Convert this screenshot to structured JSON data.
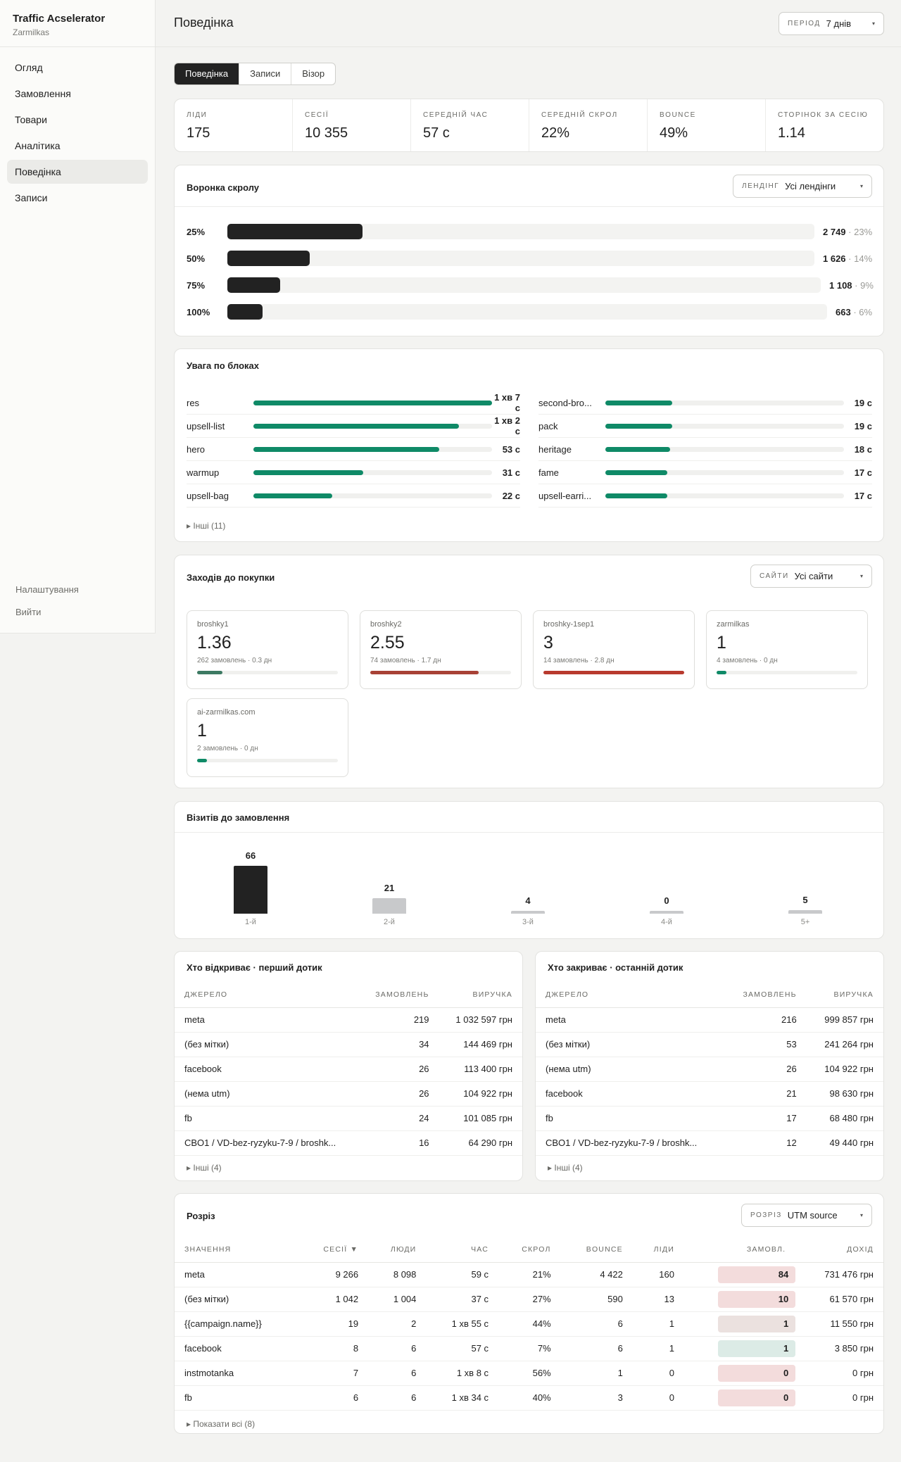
{
  "sidebar": {
    "title": "Traffic Acselerator",
    "subtitle": "Zarmilkas",
    "items": [
      "Огляд",
      "Замовлення",
      "Товари",
      "Аналітика",
      "Поведінка",
      "Записи"
    ],
    "active": 4,
    "footer": [
      "Налаштування",
      "Вийти"
    ]
  },
  "header": {
    "title": "Поведінка",
    "period_label": "ПЕРІОД",
    "period_value": "7 днів"
  },
  "tabs": [
    "Поведінка",
    "Записи",
    "Візор"
  ],
  "kpis": [
    {
      "label": "Ліди",
      "value": "175"
    },
    {
      "label": "Сесії",
      "value": "10 355"
    },
    {
      "label": "Середній час",
      "value": "57 с"
    },
    {
      "label": "Середній скрол",
      "value": "22%"
    },
    {
      "label": "Bounce",
      "value": "49%"
    },
    {
      "label": "Сторінок за сесію",
      "value": "1.14"
    }
  ],
  "funnel": {
    "title": "Воронка скролу",
    "filter_label": "ЛЕНДІНГ",
    "filter_value": "Усі лендінги",
    "rows": [
      {
        "pct": "25%",
        "count": "2 749",
        "share": "23%",
        "fill": 0.23
      },
      {
        "pct": "50%",
        "count": "1 626",
        "share": "14%",
        "fill": 0.14
      },
      {
        "pct": "75%",
        "count": "1 108",
        "share": "9%",
        "fill": 0.09
      },
      {
        "pct": "100%",
        "count": "663",
        "share": "6%",
        "fill": 0.06
      }
    ]
  },
  "attention": {
    "title": "Увага по блоках",
    "left": [
      {
        "name": "res",
        "value": "1 хв 7 с",
        "fill": 1.0
      },
      {
        "name": "upsell-list",
        "value": "1 хв 2 с",
        "fill": 0.86
      },
      {
        "name": "hero",
        "value": "53 с",
        "fill": 0.78
      },
      {
        "name": "warmup",
        "value": "31 с",
        "fill": 0.46
      },
      {
        "name": "upsell-bag",
        "value": "22 с",
        "fill": 0.33
      }
    ],
    "right": [
      {
        "name": "second-bro...",
        "value": "19 с",
        "fill": 0.28
      },
      {
        "name": "pack",
        "value": "19 с",
        "fill": 0.28
      },
      {
        "name": "heritage",
        "value": "18 с",
        "fill": 0.27
      },
      {
        "name": "fame",
        "value": "17 с",
        "fill": 0.26
      },
      {
        "name": "upsell-earri...",
        "value": "17 с",
        "fill": 0.26
      }
    ],
    "more": "▸ Інші (11)"
  },
  "visits_to_buy": {
    "title": "Заходів до покупки",
    "filter_label": "САЙТИ",
    "filter_value": "Усі сайти",
    "sites": [
      {
        "name": "broshky1",
        "value": "1.36",
        "sub": "262 замовлень · 0.3 дн",
        "fill": 0.18,
        "color": "#3d7a63"
      },
      {
        "name": "broshky2",
        "value": "2.55",
        "sub": "74 замовлень · 1.7 дн",
        "fill": 0.77,
        "color": "#a84236"
      },
      {
        "name": "broshky-1sep1",
        "value": "3",
        "sub": "14 замовлень · 2.8 дн",
        "fill": 1.0,
        "color": "#b83a2e"
      },
      {
        "name": "zarmilkas",
        "value": "1",
        "sub": "4 замовлень · 0 дн",
        "fill": 0.07,
        "color": "#0f8a67"
      },
      {
        "name": "ai-zarmilkas.com",
        "value": "1",
        "sub": "2 замовлень · 0 дн",
        "fill": 0.07,
        "color": "#0f8a67"
      }
    ]
  },
  "visits_to_order": {
    "title": "Візитів до замовлення",
    "bars": [
      {
        "label": "1-й",
        "value": 66,
        "color": "#222"
      },
      {
        "label": "2-й",
        "value": 21,
        "color": "#c8c9cb"
      },
      {
        "label": "3-й",
        "value": 4,
        "color": "#c8c9cb"
      },
      {
        "label": "4-й",
        "value": 0,
        "color": "#c8c9cb"
      },
      {
        "label": "5+",
        "value": 5,
        "color": "#c8c9cb"
      }
    ]
  },
  "first_touch": {
    "title": "Хто відкриває · перший дотик",
    "cols": [
      "Джерело",
      "Замовлень",
      "Виручка"
    ],
    "rows": [
      [
        "meta",
        "219",
        "1 032 597 грн"
      ],
      [
        "(без мітки)",
        "34",
        "144 469 грн"
      ],
      [
        "facebook",
        "26",
        "113 400 грн"
      ],
      [
        "(нема utm)",
        "26",
        "104 922 грн"
      ],
      [
        "fb",
        "24",
        "101 085 грн"
      ],
      [
        "CBO1 / VD-bez-ryzyku-7-9 / broshk...",
        "16",
        "64 290 грн"
      ]
    ],
    "more": "▸ Інші (4)"
  },
  "last_touch": {
    "title": "Хто закриває · останній дотик",
    "cols": [
      "Джерело",
      "Замовлень",
      "Виручка"
    ],
    "rows": [
      [
        "meta",
        "216",
        "999 857 грн"
      ],
      [
        "(без мітки)",
        "53",
        "241 264 грн"
      ],
      [
        "(нема utm)",
        "26",
        "104 922 грн"
      ],
      [
        "facebook",
        "21",
        "98 630 грн"
      ],
      [
        "fb",
        "17",
        "68 480 грн"
      ],
      [
        "CBO1 / VD-bez-ryzyku-7-9 / broshk...",
        "12",
        "49 440 грн"
      ]
    ],
    "more": "▸ Інші (4)"
  },
  "breakdown": {
    "title": "Розріз",
    "filter_label": "РОЗРІЗ",
    "filter_value": "UTM source",
    "cols": [
      "Значення",
      "Сесії ▼",
      "Люди",
      "Час",
      "Скрол",
      "Bounce",
      "Ліди",
      "Замовл.",
      "Дохід"
    ],
    "rows": [
      [
        "meta",
        "9 266",
        "8 098",
        "59 с",
        "21%",
        "4 422",
        "160",
        "84",
        "731 476 грн"
      ],
      [
        "(без мітки)",
        "1 042",
        "1 004",
        "37 с",
        "27%",
        "590",
        "13",
        "10",
        "61 570 грн"
      ],
      [
        "{{campaign.name}}",
        "19",
        "2",
        "1 хв 55 с",
        "44%",
        "6",
        "1",
        "1",
        "11 550 грн"
      ],
      [
        "facebook",
        "8",
        "6",
        "57 с",
        "7%",
        "6",
        "1",
        "1",
        "3 850 грн"
      ],
      [
        "instmotanka",
        "7",
        "6",
        "1 хв 8 с",
        "56%",
        "1",
        "0",
        "0",
        "0 грн"
      ],
      [
        "fb",
        "6",
        "6",
        "1 хв 34 с",
        "40%",
        "3",
        "0",
        "0",
        "0 грн"
      ]
    ],
    "badge_colors": [
      "#f3dcdc",
      "#f3dcdc",
      "#ebe1df",
      "#dcebe6",
      "#f3dcdc",
      "#f3dcdc"
    ],
    "more": "▸ Показати всі (8)"
  }
}
